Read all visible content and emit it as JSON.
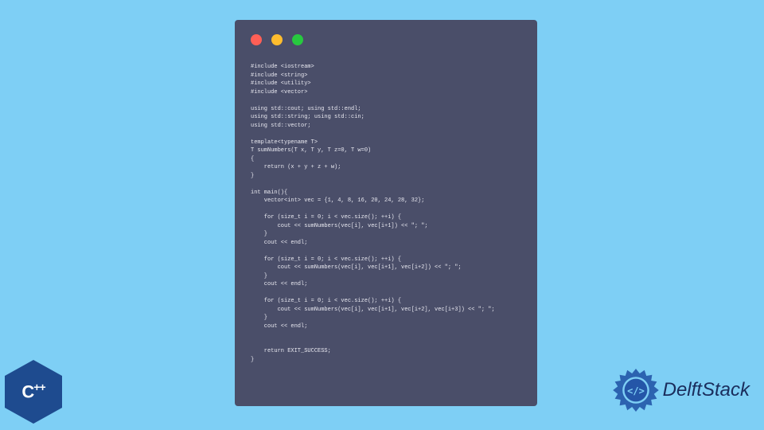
{
  "window": {
    "buttons": [
      "close",
      "minimize",
      "maximize"
    ]
  },
  "code": "#include <iostream>\n#include <string>\n#include <utility>\n#include <vector>\n\nusing std::cout; using std::endl;\nusing std::string; using std::cin;\nusing std::vector;\n\ntemplate<typename T>\nT sumNumbers(T x, T y, T z=0, T w=0)\n{\n    return (x + y + z + w);\n}\n\nint main(){\n    vector<int> vec = {1, 4, 8, 16, 20, 24, 28, 32};\n\n    for (size_t i = 0; i < vec.size(); ++i) {\n        cout << sumNumbers(vec[i], vec[i+1]) << \"; \";\n    }\n    cout << endl;\n\n    for (size_t i = 0; i < vec.size(); ++i) {\n        cout << sumNumbers(vec[i], vec[i+1], vec[i+2]) << \"; \";\n    }\n    cout << endl;\n\n    for (size_t i = 0; i < vec.size(); ++i) {\n        cout << sumNumbers(vec[i], vec[i+1], vec[i+2], vec[i+3]) << \"; \";\n    }\n    cout << endl;\n\n\n    return EXIT_SUCCESS;\n}",
  "cpp_badge": {
    "text": "C",
    "plus": "++"
  },
  "delft_logo": {
    "text": "DelftStack",
    "icon_tag": "</>"
  }
}
